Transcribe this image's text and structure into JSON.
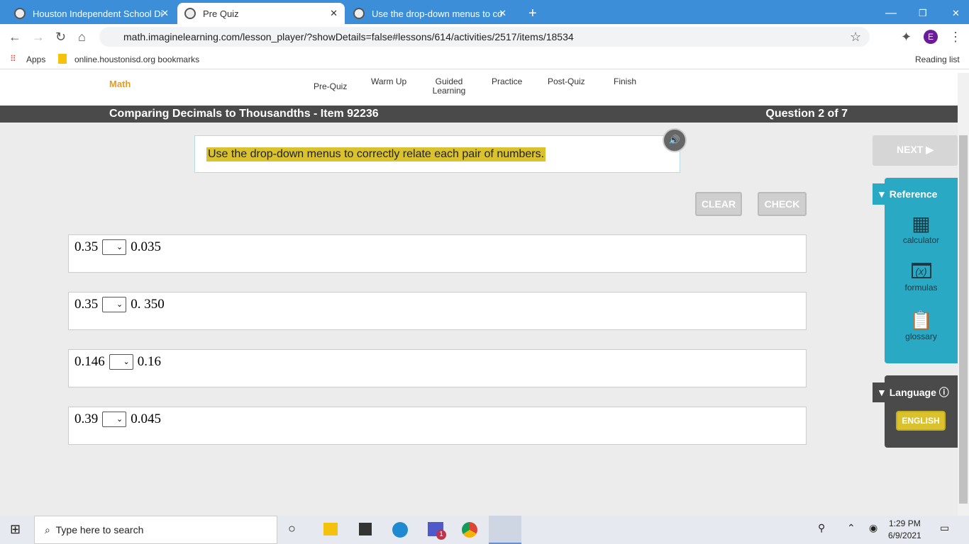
{
  "browser": {
    "tabs": [
      "Houston Independent School Di",
      "Pre Quiz",
      "Use the drop-down menus to co"
    ],
    "url": "math.imaginelearning.com/lesson_player/?showDetails=false#lessons/614/activities/2517/items/18534",
    "bookmarks": [
      "Apps",
      "online.houstonisd.org bookmarks"
    ],
    "reading_list": "Reading list",
    "profile": "E"
  },
  "header": {
    "logo": "Math",
    "nav": [
      "Pre-Quiz",
      "Warm Up",
      "Guided Learning",
      "Practice",
      "Post-Quiz",
      "Finish"
    ]
  },
  "title": "Comparing Decimals to Thousandths - Item 92236",
  "question": "Question 2 of 7",
  "prompt": "Use the drop-down menus to correctly relate each pair of numbers.",
  "buttons": {
    "clear": "CLEAR",
    "check": "CHECK",
    "next": "NEXT ▶"
  },
  "rows": [
    {
      "left": "0.35",
      "right": "0.035"
    },
    {
      "left": "0.35",
      "right": "0. 350"
    },
    {
      "left": "0.146",
      "right": "0.16"
    },
    {
      "left": "0.39",
      "right": "0.045"
    }
  ],
  "reference": {
    "title": "Reference",
    "tools": [
      "calculator",
      "formulas",
      "glossary"
    ]
  },
  "language": {
    "title": "Language",
    "button": "ENGLISH"
  },
  "taskbar": {
    "search": "Type here to search",
    "time": "1:29 PM",
    "date": "6/9/2021",
    "badge": "1"
  }
}
